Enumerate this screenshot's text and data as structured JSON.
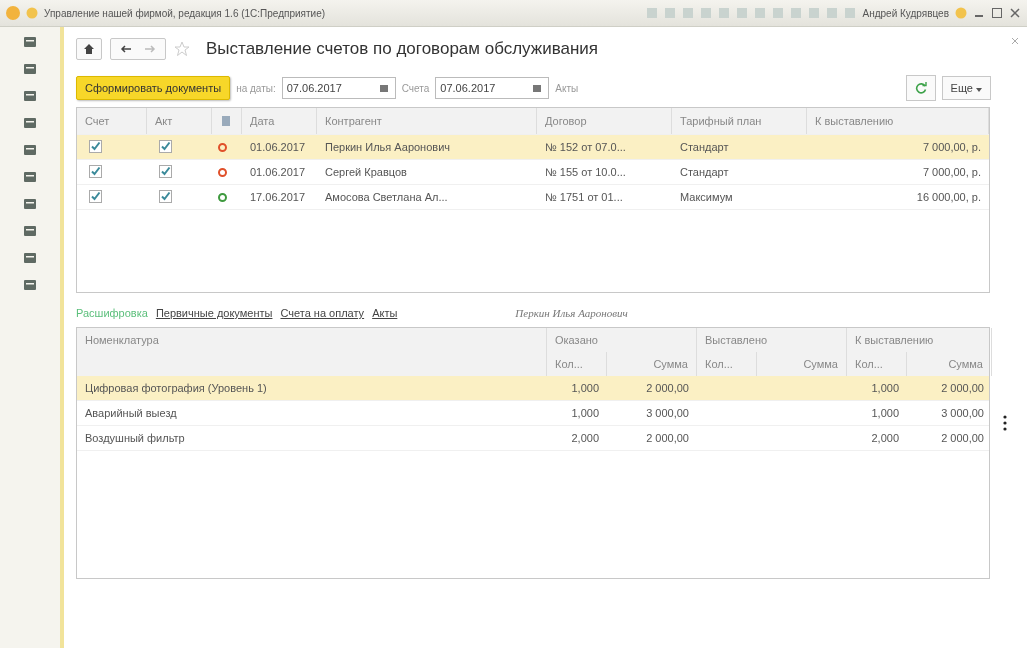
{
  "title_bar": {
    "title": "Управление нашей фирмой, редакция 1.6 (1С:Предприятие)",
    "user": "Андрей Кудрявцев"
  },
  "page": {
    "title": "Выставление счетов по договорам обслуживания"
  },
  "toolbar": {
    "generate_button": "Сформировать документы",
    "date_label": "на даты:",
    "date1": "07.06.2017",
    "invoices_label": "Счета",
    "date2": "07.06.2017",
    "acts_label": "Акты",
    "more_button": "Еще"
  },
  "top_table": {
    "columns": [
      "Счет",
      "Акт",
      "Дата",
      "Контрагент",
      "Договор",
      "Тарифный план",
      "К выставлению"
    ],
    "rows": [
      {
        "selected": true,
        "invoice_checked": true,
        "act_checked": true,
        "color": "#e0502a",
        "date": "01.06.2017",
        "counterparty": "Перкин Илья Ааронович",
        "contract": "№ 152 от 07.0...",
        "plan": "Стандарт",
        "amount": "7 000,00, р."
      },
      {
        "selected": false,
        "invoice_checked": true,
        "act_checked": true,
        "color": "#e0502a",
        "date": "01.06.2017",
        "counterparty": "Сергей Кравцов",
        "contract": "№ 155 от 10.0...",
        "plan": "Стандарт",
        "amount": "7 000,00, р."
      },
      {
        "selected": false,
        "invoice_checked": true,
        "act_checked": true,
        "color": "#3f9a3f",
        "date": "17.06.2017",
        "counterparty": "Амосова Светлана Ал...",
        "contract": "№ 1751 от 01...",
        "plan": "Максимум",
        "amount": "16 000,00, р."
      }
    ]
  },
  "tabs": [
    {
      "label": "Расшифровка",
      "selected": true
    },
    {
      "label": "Первичные документы",
      "selected": false
    },
    {
      "label": "Счета на оплату",
      "selected": false
    },
    {
      "label": "Акты",
      "selected": false
    }
  ],
  "selected_counterparty": "Перкин Илья Ааронович",
  "bottom_table": {
    "first_column": "Номенклатура",
    "groups": [
      {
        "title": "Оказано",
        "qty": "Кол...",
        "sum": "Сумма"
      },
      {
        "title": "Выставлено",
        "qty": "Кол...",
        "sum": "Сумма"
      },
      {
        "title": "К выставлению",
        "qty": "Кол...",
        "sum": "Сумма"
      }
    ],
    "rows": [
      {
        "selected": true,
        "name": "Цифровая фотография (Уровень 1)",
        "done_qty": "1,000",
        "done_sum": "2 000,00",
        "due_qty": "1,000",
        "due_sum": "2 000,00"
      },
      {
        "selected": false,
        "name": "Аварийный выезд",
        "done_qty": "1,000",
        "done_sum": "3 000,00",
        "due_qty": "1,000",
        "due_sum": "3 000,00"
      },
      {
        "selected": false,
        "name": "Воздушный фильтр",
        "done_qty": "2,000",
        "done_sum": "2 000,00",
        "due_qty": "2,000",
        "due_sum": "2 000,00"
      }
    ]
  }
}
